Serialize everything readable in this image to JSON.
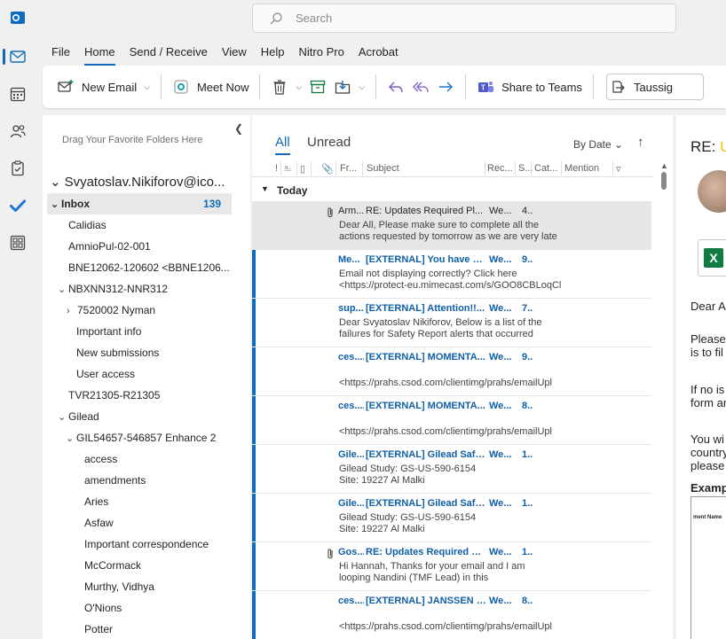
{
  "app": {
    "search_placeholder": "Search",
    "menu_tabs": [
      "File",
      "Home",
      "Send / Receive",
      "View",
      "Help",
      "Nitro Pro",
      "Acrobat"
    ],
    "rail_icons": [
      "outlook-logo-icon",
      "mail-icon",
      "calendar-icon",
      "people-icon",
      "tasks-icon",
      "todo-icon",
      "apps-icon"
    ]
  },
  "ribbon": {
    "new_email": "New Email",
    "meet_now": "Meet Now",
    "share_to_teams": "Share to Teams",
    "quick_step": "Taussig"
  },
  "folders": {
    "drag_hint": "Drag Your Favorite Folders Here",
    "account": "Svyatoslav.Nikiforov@ico...",
    "items": [
      {
        "label": "Inbox",
        "count": "139"
      },
      {
        "label": "Calidias"
      },
      {
        "label": "AmnioPul-02-001"
      },
      {
        "label": "BNE12062-120602 <BBNE1206..."
      },
      {
        "label": "NBXNN312-NNR312"
      },
      {
        "label": "7520002 Nyman"
      },
      {
        "label": "Important info"
      },
      {
        "label": "New submissions"
      },
      {
        "label": "User access"
      },
      {
        "label": "TVR21305-R21305"
      },
      {
        "label": "Gilead"
      },
      {
        "label": "GIL54657-546857 Enhance 2"
      },
      {
        "label": "access"
      },
      {
        "label": "amendments"
      },
      {
        "label": "Aries"
      },
      {
        "label": "Asfaw"
      },
      {
        "label": "Important correspondence"
      },
      {
        "label": "McCormack"
      },
      {
        "label": "Murthy, Vidhya"
      },
      {
        "label": "O'Nions"
      },
      {
        "label": "Potter"
      }
    ]
  },
  "list": {
    "tab_all": "All",
    "tab_unread": "Unread",
    "sort_label": "By Date",
    "columns": {
      "from": "Fr...",
      "subject": "Subject",
      "received": "Rec...",
      "size": "S...",
      "category": "Cat...",
      "mention": "Mention"
    },
    "group_label": "Today",
    "messages": [
      {
        "from": "Arm...",
        "subject": "RE: Updates Required Pl...",
        "received": "We...",
        "size": "4..",
        "preview": "Dear All,  Please make sure to complete all the\nactions requested by tomorrow as we are very late",
        "unread": false,
        "attachment": true
      },
      {
        "from": "Me...",
        "subject": "[EXTERNAL] You have b...",
        "received": "We...",
        "size": "9..",
        "preview": "Email not displaying correctly? Click here\n<https://protect-eu.mimecast.com/s/GOO8CBLoqCl",
        "unread": true,
        "attachment": false
      },
      {
        "from": "sup...",
        "subject": "[EXTERNAL] Attention!!...",
        "received": "We...",
        "size": "7..",
        "preview": "Dear Svyatoslav Nikiforov,  Below is a list of the\nfailures for Safety Report alerts that occurred",
        "unread": true,
        "attachment": false
      },
      {
        "from": "ces....",
        "subject": "[EXTERNAL] MOMENTA...",
        "received": "We...",
        "size": "9..",
        "preview": "\n<https://prahs.csod.com/clientimg/prahs/emailUpl",
        "unread": true,
        "attachment": false
      },
      {
        "from": "ces....",
        "subject": "[EXTERNAL] MOMENTA...",
        "received": "We...",
        "size": "8..",
        "preview": "\n<https://prahs.csod.com/clientimg/prahs/emailUpl",
        "unread": true,
        "attachment": false
      },
      {
        "from": "Gile...",
        "subject": "[EXTERNAL] Gilead Safe...",
        "received": "We...",
        "size": "1..",
        "preview": "Gilead Study: GS-US-590-6154\nSite: 19227 Al Malki",
        "unread": true,
        "attachment": false
      },
      {
        "from": "Gile...",
        "subject": "[EXTERNAL] Gilead Safe...",
        "received": "We...",
        "size": "1..",
        "preview": "Gilead Study: GS-US-590-6154\nSite: 19227 Al Malki",
        "unread": true,
        "attachment": false
      },
      {
        "from": "Gos...",
        "subject": "RE: Updates Required Pl...",
        "received": "We...",
        "size": "1..",
        "preview": "Hi Hannah,  Thanks for your email and I am\nlooping Nandini (TMF Lead) in this",
        "unread": true,
        "attachment": true
      },
      {
        "from": "ces....",
        "subject": "[EXTERNAL] JANSSEN J...",
        "received": "We...",
        "size": "8..",
        "preview": "\n<https://prahs.csod.com/clientimg/prahs/emailUpl",
        "unread": true,
        "attachment": false
      }
    ]
  },
  "reading": {
    "title_prefix": "RE: ",
    "title_rest": "U",
    "lines": [
      "Dear A",
      "Please",
      "is to fil",
      "If no is",
      "form ar",
      "You wi",
      "country",
      "please",
      "Examp"
    ],
    "sheet_label": "ment Name"
  },
  "colors": {
    "accent": "#0f6cbd",
    "unread_text": "#0f5fa8",
    "excel": "#107c41"
  }
}
